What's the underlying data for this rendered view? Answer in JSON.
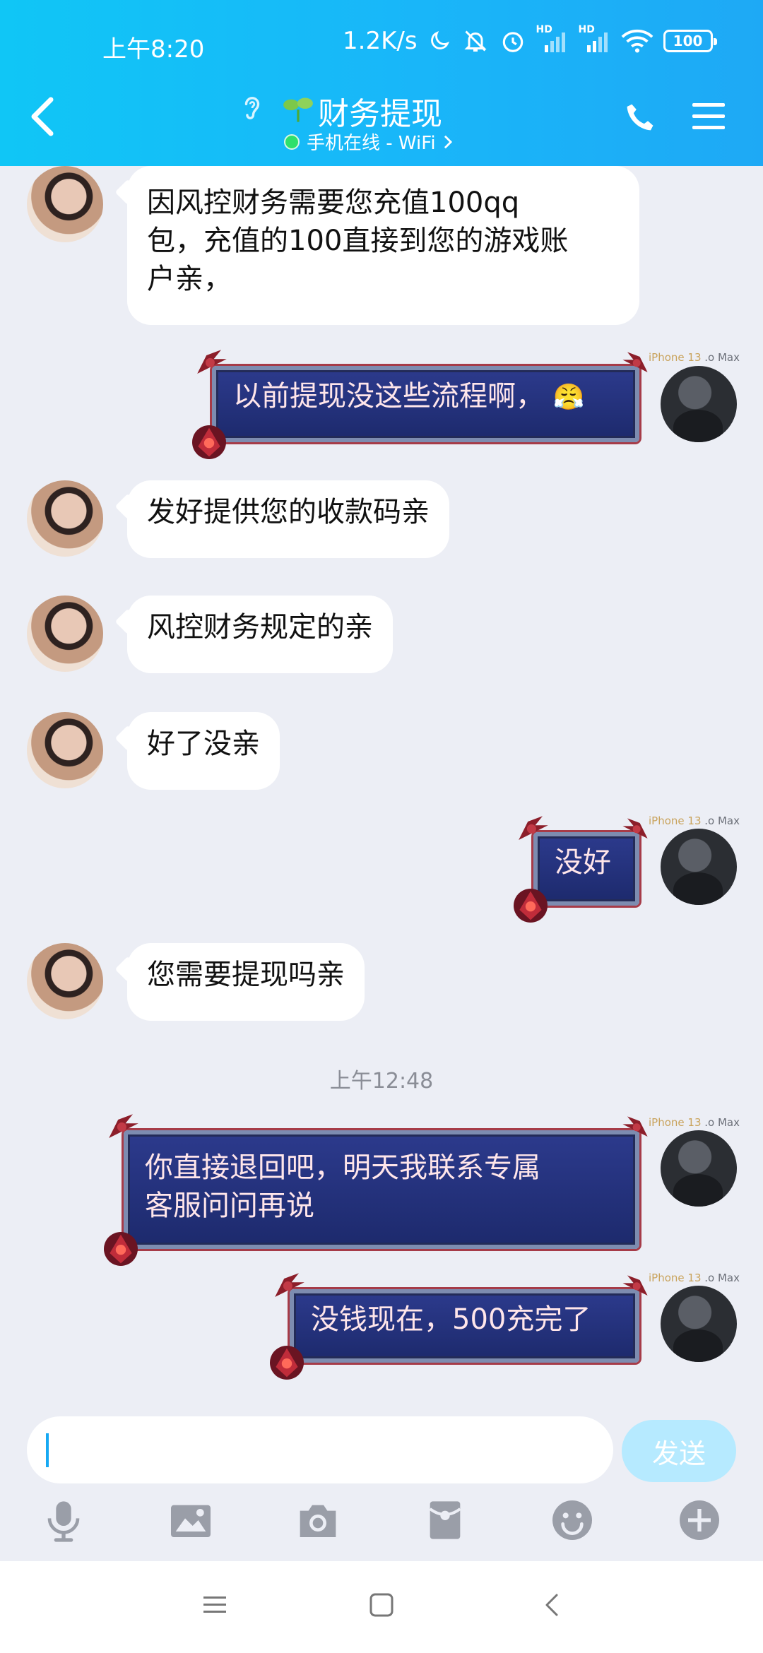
{
  "status_bar": {
    "time": "上午8:20",
    "network_speed": "1.2K/s",
    "hd1": "HD",
    "hd2": "HD",
    "battery": "100"
  },
  "header": {
    "title": "财务提现",
    "subtitle": "手机在线 - WiFi",
    "colors": {
      "gradient_start": "#10c6f6",
      "gradient_end": "#1ea9f5"
    }
  },
  "messages": [
    {
      "direction": "incoming",
      "lines": [
        "因风控财务需要您充值100qq",
        "包，充值的100直接到您的游戏账",
        "户亲，"
      ]
    },
    {
      "direction": "outgoing",
      "device": "iPhone 13 Pro Max",
      "text": "以前提现没这些流程啊，",
      "emoji": "😤"
    },
    {
      "direction": "incoming",
      "lines": [
        "发好提供您的收款码亲"
      ]
    },
    {
      "direction": "incoming",
      "lines": [
        "风控财务规定的亲"
      ]
    },
    {
      "direction": "incoming",
      "lines": [
        "好了没亲"
      ]
    },
    {
      "direction": "outgoing",
      "device": "iPhone 13 Pro Max",
      "text": "没好"
    },
    {
      "direction": "incoming",
      "lines": [
        "您需要提现吗亲"
      ]
    },
    {
      "direction": "outgoing",
      "device": "iPhone 13 Pro Max",
      "lines": [
        "你直接退回吧，明天我联系专属",
        "客服问问再说"
      ]
    },
    {
      "direction": "outgoing",
      "device": "iPhone 13 Pro Max",
      "text": "没钱现在，500充完了"
    }
  ],
  "time_divider": "上午12:48",
  "device_tag": {
    "brand": "iPhone 13 ",
    "model": ".o Max"
  },
  "input": {
    "value": "",
    "send_label": "发送"
  },
  "toolbar": [
    "mic-icon",
    "image-icon",
    "camera-icon",
    "red-packet-icon",
    "emoji-icon",
    "plus-icon"
  ]
}
